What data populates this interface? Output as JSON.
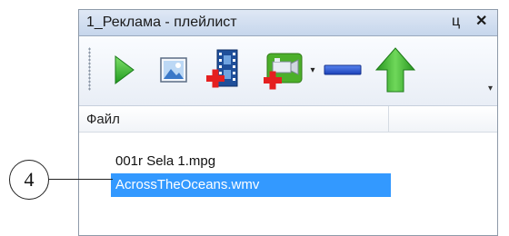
{
  "panel": {
    "title": "1_Реклама - плейлист",
    "pin_glyph": "ц",
    "close_glyph": "✕"
  },
  "toolbar": {
    "buttons": [
      {
        "name": "play-button",
        "icon": "play-icon",
        "color": "#2ea82e"
      },
      {
        "name": "image-button",
        "icon": "image-icon",
        "color": "#3c7fd0"
      },
      {
        "name": "add-video-button",
        "icon": "film-add-icon",
        "color": "#1f4f9a"
      },
      {
        "name": "add-camera-button",
        "icon": "camera-add-icon",
        "color": "#4caf2a"
      },
      {
        "name": "remove-button",
        "icon": "minus-icon",
        "color": "#1e4fd6"
      },
      {
        "name": "move-up-button",
        "icon": "arrow-up-icon",
        "color": "#2fa62f"
      }
    ],
    "overflow_glyph": "▾"
  },
  "grid": {
    "column_header": "Файл",
    "rows": [
      {
        "label": "001r Sela 1.mpg",
        "selected": false
      },
      {
        "label": "AcrossTheOceans.wmv",
        "selected": true
      }
    ],
    "selection_color": "#3399ff"
  },
  "callout": {
    "label": "4"
  }
}
